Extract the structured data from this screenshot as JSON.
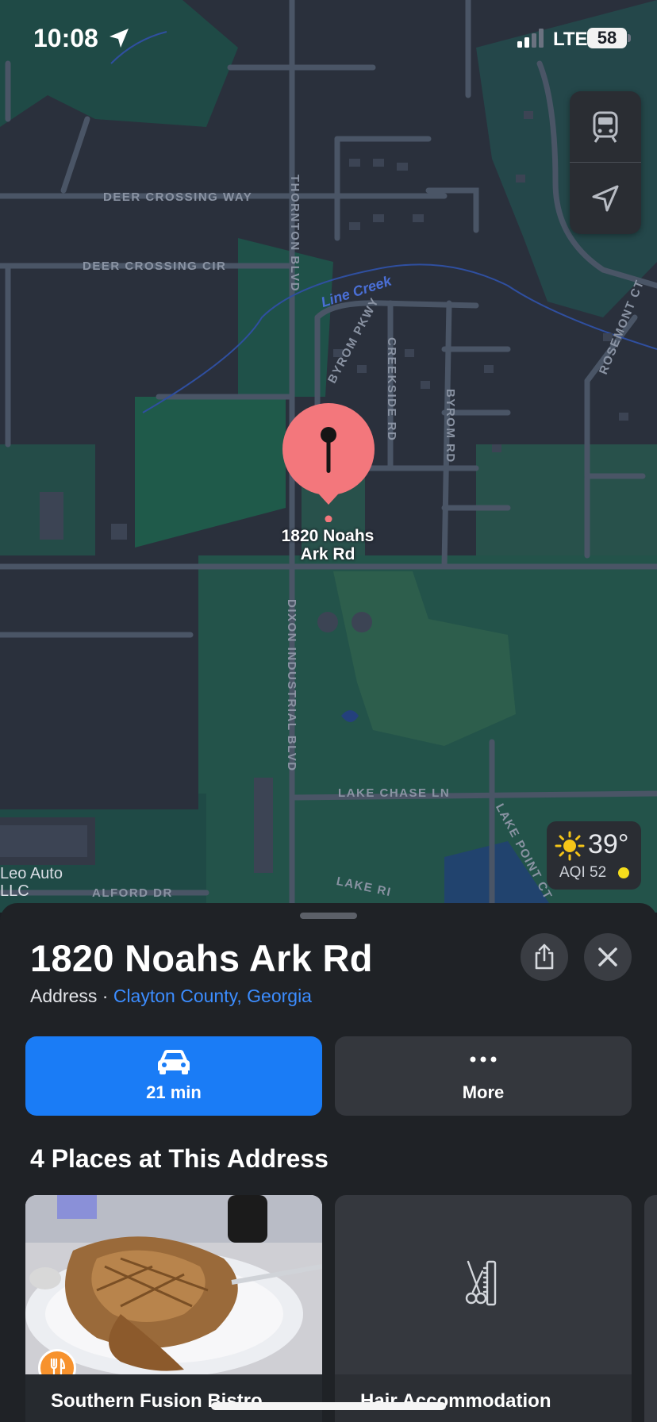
{
  "status_bar": {
    "time": "10:08",
    "network": "LTE",
    "battery": "58"
  },
  "map": {
    "streets": {
      "deer_crossing_way": "DEER CROSSING WAY",
      "deer_crossing_cir": "DEER CROSSING CIR",
      "thornton_blvd": "THORNTON BLVD",
      "byrom_pkwy": "BYROM PKWY",
      "creekside_rd": "CREEKSIDE RD",
      "byrom_rd": "BYROM RD",
      "rosemont_ct": "ROSEMONT CT",
      "dixon_industrial_blvd": "DIXON INDUSTRIAL BLVD",
      "lake_chase_ln": "LAKE CHASE LN",
      "lake_point_ct": "LAKE POINT CT",
      "lake_ri": "LAKE RI",
      "alford_dr": "ALFORD DR"
    },
    "creek": "Line Creek",
    "poi": "Leo Auto\nLLC",
    "pin_label": "1820 Noahs\nArk Rd",
    "weather": {
      "temp": "39°",
      "aqi": "AQI 52",
      "aqi_color": "#f5dd1c"
    },
    "controls": {
      "transit": "train-icon",
      "location": "location-arrow-icon"
    }
  },
  "sheet": {
    "title": "1820 Noahs Ark Rd",
    "subtitle_type": "Address · ",
    "subtitle_link": "Clayton County, Georgia",
    "actions": {
      "directions_label": "21 min",
      "more_label": "More"
    },
    "section_title": "4 Places at This Address",
    "places": [
      {
        "name": "Southern Fusion Bistro",
        "icon": "fork-knife-icon"
      },
      {
        "name": "Hair Accommodation",
        "icon": "scissors-comb-icon"
      }
    ]
  },
  "colors": {
    "accent": "#1a7cf6",
    "pin": "#f3777c",
    "link": "#3c8dff"
  }
}
